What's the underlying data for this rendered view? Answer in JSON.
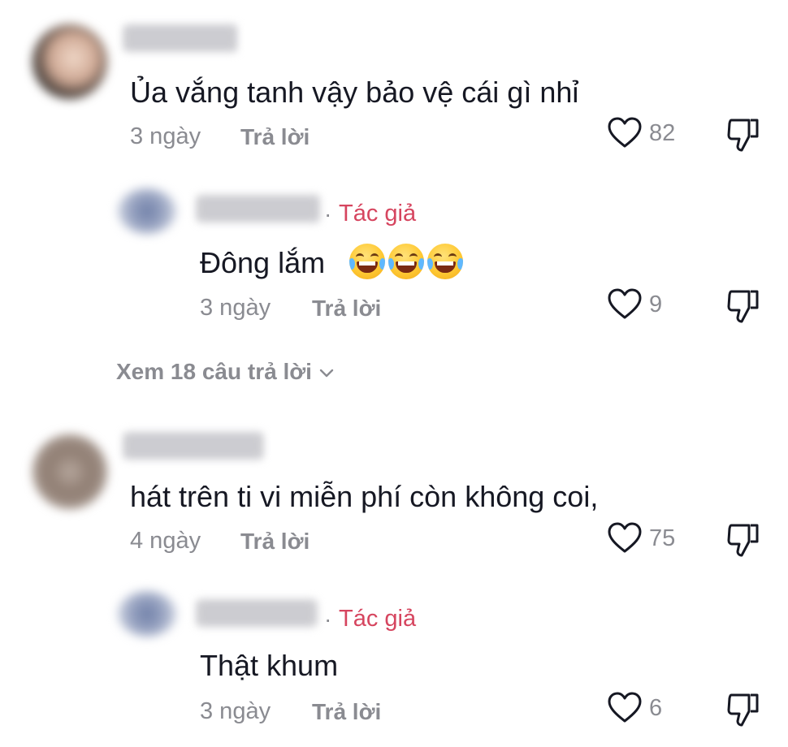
{
  "colors": {
    "text": "#161823",
    "muted": "#8a8b91",
    "author_tag": "#d6455f",
    "background": "#ffffff"
  },
  "comments": [
    {
      "text": "Ủa vắng tanh vậy bảo vệ cái gì nhỉ",
      "time": "3 ngày",
      "reply_label": "Trả lời",
      "likes": "82",
      "replies": [
        {
          "author_tag": "Tác giả",
          "separator": "·",
          "text": "Đông lắm",
          "emojis": [
            "face-with-tears-of-joy",
            "face-with-tears-of-joy",
            "face-with-tears-of-joy"
          ],
          "time": "3 ngày",
          "reply_label": "Trả lời",
          "likes": "9"
        }
      ],
      "view_more_label": "Xem 18 câu trả lời"
    },
    {
      "text": "hát trên ti vi miễn phí còn không coi,",
      "time": "4 ngày",
      "reply_label": "Trả lời",
      "likes": "75",
      "replies": [
        {
          "author_tag": "Tác giả",
          "separator": "·",
          "text": "Thật khum",
          "time": "3 ngày",
          "reply_label": "Trả lời",
          "likes": "6"
        }
      ]
    }
  ],
  "icons": {
    "like": "heart-icon",
    "dislike": "thumbs-down-icon",
    "expand": "chevron-down-icon"
  }
}
